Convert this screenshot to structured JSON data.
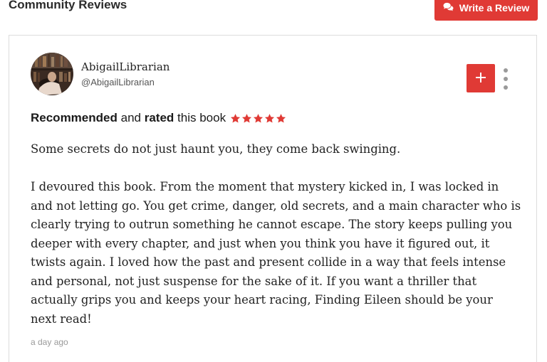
{
  "section": {
    "title": "Community Reviews"
  },
  "write_review": {
    "label": "Write a Review",
    "icon": "comments-icon"
  },
  "review": {
    "reviewer": {
      "name": "AbigailLibrarian",
      "handle": "@AbigailLibrarian"
    },
    "verdict": {
      "recommended": "Recommended",
      "and": "and",
      "rated": "rated",
      "this_book": "this book"
    },
    "rating": 5,
    "max_rating": 5,
    "paragraphs": [
      "Some secrets do not just haunt you, they come back swinging.",
      "I devoured this book. From the moment that mystery kicked in, I was locked in and not letting go. You get crime, danger, old secrets, and a main character who is clearly trying to outrun something he cannot escape. The story keeps pulling you deeper with every chapter, and just when you think you have it figured out, it twists again. I loved how the past and present collide in a way that feels intense and personal, not just suspense for the sake of it. If you want a thriller that actually grips you and keeps your heart racing, Finding Eileen should be your next read!"
    ],
    "timestamp": "a day ago"
  },
  "colors": {
    "accent": "#e03a35",
    "star": "#e03a35",
    "muted": "#9a9a9a"
  }
}
